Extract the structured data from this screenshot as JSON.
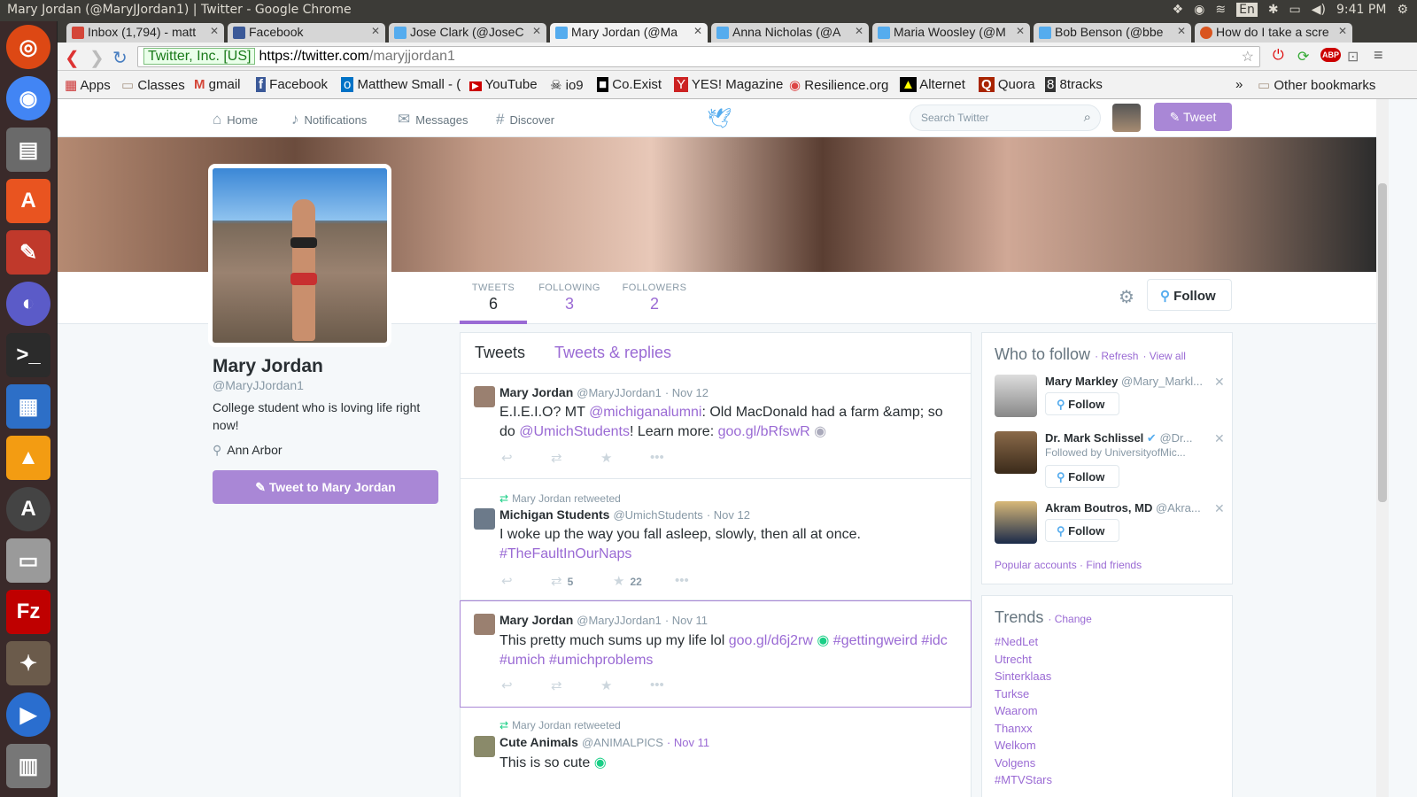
{
  "os_bar": {
    "window_title": "Mary Jordan (@MaryJJordan1) | Twitter - Google Chrome",
    "lang": "En",
    "time": "9:41 PM"
  },
  "tabs": [
    {
      "label": "Inbox (1,794) - matt",
      "color": "#d44638"
    },
    {
      "label": "Facebook",
      "color": "#3b5998"
    },
    {
      "label": "Jose Clark (@JoseC",
      "color": "#55acee"
    },
    {
      "label": "Mary Jordan (@Ma",
      "color": "#55acee",
      "active": true
    },
    {
      "label": "Anna Nicholas (@A",
      "color": "#55acee"
    },
    {
      "label": "Maria Woosley (@M",
      "color": "#55acee"
    },
    {
      "label": "Bob Benson (@bbe",
      "color": "#55acee"
    },
    {
      "label": "How do I take a scre",
      "color": "#d9541e"
    }
  ],
  "address": {
    "security_label": "Twitter, Inc. [US]",
    "url_host": "https://twitter.com",
    "url_path": "/maryjjordan1"
  },
  "bookmarks": [
    "Apps",
    "Classes",
    "gmail",
    "Facebook",
    "Matthew Small - (",
    "YouTube",
    "io9",
    "Co.Exist",
    "YES! Magazine",
    "Resilience.org",
    "Alternet",
    "Quora",
    "8tracks",
    "Other bookmarks"
  ],
  "twitter_nav": {
    "home": "Home",
    "notifications": "Notifications",
    "messages": "Messages",
    "discover": "Discover",
    "search_placeholder": "Search Twitter",
    "tweet_button": "Tweet"
  },
  "profile": {
    "name": "Mary Jordan",
    "handle": "@MaryJJordan1",
    "bio": "College student who is loving life right now!",
    "location": "Ann Arbor",
    "tweet_to_button": "Tweet to Mary Jordan",
    "follow_button": "Follow",
    "stats": [
      {
        "label": "TWEETS",
        "value": "6"
      },
      {
        "label": "FOLLOWING",
        "value": "3"
      },
      {
        "label": "FOLLOWERS",
        "value": "2"
      }
    ]
  },
  "timeline": {
    "tab_tweets": "Tweets",
    "tab_replies": "Tweets & replies",
    "tweets": [
      {
        "name": "Mary Jordan",
        "handle": "@MaryJJordan1",
        "date": "· Nov 12",
        "text_a": "E.I.E.I.O? MT ",
        "link_a": "@michiganalumni",
        "text_b": ": Old MacDonald had a farm &amp; so do ",
        "link_b": "@UmichStudents",
        "text_c": "! Learn more: ",
        "link_c": "goo.gl/bRfswR"
      },
      {
        "retweeted_by": "Mary Jordan retweeted",
        "name": "Michigan Students",
        "handle": "@UmichStudents",
        "date": "· Nov 12",
        "text_a": "I woke up the way you fall asleep, slowly, then all at once.",
        "link_a": "#TheFaultInOurNaps",
        "retweets": "5",
        "favorites": "22"
      },
      {
        "name": "Mary Jordan",
        "handle": "@MaryJJordan1",
        "date": "· Nov 11",
        "text_a": "This pretty much sums up my life lol ",
        "link_a": "goo.gl/d6j2rw",
        "link_b": "#gettingweird",
        "link_c": "#idc",
        "link_d": "#umich",
        "link_e": "#umichproblems"
      },
      {
        "retweeted_by": "Mary Jordan retweeted",
        "name": "Cute Animals",
        "handle": "@ANIMALPICS",
        "date": "· Nov 11",
        "text_a": "This is so cute"
      }
    ]
  },
  "who_to_follow": {
    "title": "Who to follow",
    "refresh": "· Refresh",
    "view_all": "· View all",
    "follow_label": "Follow",
    "suggestions": [
      {
        "name": "Mary Markley",
        "handle": "@Mary_Markl...",
        "sub": ""
      },
      {
        "name": "Dr. Mark Schlissel",
        "handle": "@Dr...",
        "sub": "Followed by UniversityofMic..."
      },
      {
        "name": "Akram Boutros, MD",
        "handle": "@Akra...",
        "sub": ""
      }
    ],
    "footer": "Popular accounts · Find friends"
  },
  "trends": {
    "title": "Trends",
    "change": "· Change",
    "items": [
      "#NedLet",
      "Utrecht",
      "Sinterklaas",
      "Turkse",
      "Waarom",
      "Thanxx",
      "Welkom",
      "Volgens",
      "#MTVStars"
    ]
  }
}
